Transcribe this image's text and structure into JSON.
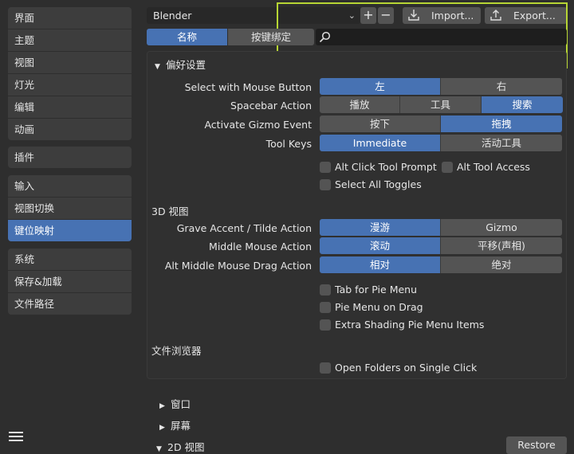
{
  "sidebar": {
    "group1": [
      "界面",
      "主题",
      "视图",
      "灯光",
      "编辑",
      "动画"
    ],
    "group2": [
      "插件"
    ],
    "group3": [
      "输入",
      "视图切换",
      "键位映射"
    ],
    "group4": [
      "系统",
      "保存&加载",
      "文件路径"
    ],
    "active": "键位映射"
  },
  "topbar": {
    "preset": "Blender",
    "add": "+",
    "remove": "−",
    "import_label": "Import...",
    "export_label": "Export..."
  },
  "tabs": {
    "name": "名称",
    "key_binding": "按键绑定"
  },
  "search": {
    "placeholder": ""
  },
  "prefs": {
    "title": "偏好设置",
    "rows": {
      "select_mouse": {
        "label": "Select with Mouse Button",
        "opts": [
          "左",
          "右"
        ]
      },
      "spacebar": {
        "label": "Spacebar Action",
        "opts": [
          "播放",
          "工具",
          "搜索"
        ]
      },
      "gizmo": {
        "label": "Activate Gizmo Event",
        "opts": [
          "按下",
          "拖拽"
        ]
      },
      "toolkeys": {
        "label": "Tool Keys",
        "opts": [
          "Immediate",
          "活动工具"
        ]
      }
    },
    "checks": {
      "alt_click": "Alt Click Tool Prompt",
      "alt_tool": "Alt Tool Access",
      "select_all": "Select All Toggles"
    }
  },
  "view3d": {
    "title": "3D 视图",
    "rows": {
      "grave": {
        "label": "Grave Accent / Tilde Action",
        "opts": [
          "漫游",
          "Gizmo"
        ]
      },
      "mmb": {
        "label": "Middle Mouse Action",
        "opts": [
          "滚动",
          "平移(声相)"
        ]
      },
      "alt_mmb": {
        "label": "Alt Middle Mouse Drag Action",
        "opts": [
          "相对",
          "绝对"
        ]
      }
    },
    "checks": {
      "tab_pie": "Tab for Pie Menu",
      "pie_drag": "Pie Menu on Drag",
      "extra_shading": "Extra Shading Pie Menu Items"
    }
  },
  "filebrowser": {
    "title": "文件浏览器",
    "open_folders": "Open Folders on Single Click"
  },
  "collapsed": {
    "window": "窗口",
    "screen": "屏幕",
    "view2d": "2D 视图"
  },
  "restore_label": "Restore",
  "colors": {
    "accent": "#4772b3",
    "highlight": "#b7d534",
    "bg": "#2e2e2e",
    "button": "#545454"
  }
}
